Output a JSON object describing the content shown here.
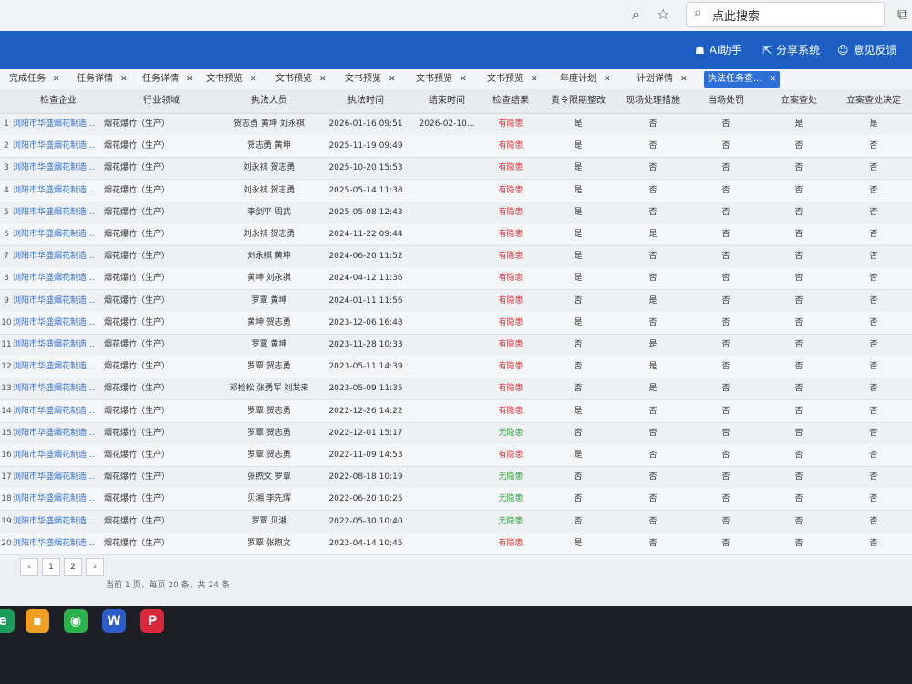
{
  "topbar": {
    "search_placeholder": "点此搜索"
  },
  "header": {
    "ai_label": "AI助手",
    "share_label": "分享系统",
    "feedback_label": "意见反馈"
  },
  "tabs": [
    {
      "label": "完成任务",
      "active": false
    },
    {
      "label": "任务详情",
      "active": false
    },
    {
      "label": "任务详情",
      "active": false
    },
    {
      "label": "文书预览",
      "active": false
    },
    {
      "label": "文书预览",
      "active": false
    },
    {
      "label": "文书预览",
      "active": false
    },
    {
      "label": "文书预览",
      "active": false
    },
    {
      "label": "文书预览",
      "active": false
    },
    {
      "label": "年度计划",
      "active": false
    },
    {
      "label": "计划详情",
      "active": false
    },
    {
      "label": "执法任务查...",
      "active": true
    }
  ],
  "table": {
    "columns": [
      "检查企业",
      "行业领域",
      "执法人员",
      "执法时间",
      "结束时间",
      "检查结果",
      "责令限期整改",
      "现场处理措施",
      "当场处罚",
      "立案查处",
      "立案查处决定"
    ],
    "rows": [
      [
        "1",
        "浏阳市华盛烟花制造...",
        "烟花爆竹（生产）",
        "贺志勇 黄坤 刘永祺",
        "2026-01-16 09:51",
        "2026-02-10...",
        "有隐患",
        "是",
        "否",
        "否",
        "是",
        "是"
      ],
      [
        "2",
        "浏阳市华盛烟花制造...",
        "烟花爆竹（生产）",
        "贺志勇 黄坤",
        "2025-11-19 09:49",
        "",
        "有隐患",
        "是",
        "否",
        "否",
        "否",
        "否"
      ],
      [
        "3",
        "浏阳市华盛烟花制造...",
        "烟花爆竹（生产）",
        "刘永祺 贺志勇",
        "2025-10-20 15:53",
        "",
        "有隐患",
        "是",
        "否",
        "否",
        "否",
        "否"
      ],
      [
        "4",
        "浏阳市华盛烟花制造...",
        "烟花爆竹（生产）",
        "刘永祺 贺志勇",
        "2025-05-14 11:38",
        "",
        "有隐患",
        "是",
        "否",
        "否",
        "否",
        "否"
      ],
      [
        "5",
        "浏阳市华盛烟花制造...",
        "烟花爆竹（生产）",
        "李剑平 周武",
        "2025-05-08 12:43",
        "",
        "有隐患",
        "是",
        "否",
        "否",
        "否",
        "否"
      ],
      [
        "6",
        "浏阳市华盛烟花制造...",
        "烟花爆竹（生产）",
        "刘永祺 贺志勇",
        "2024-11-22 09:44",
        "",
        "有隐患",
        "是",
        "是",
        "否",
        "否",
        "否"
      ],
      [
        "7",
        "浏阳市华盛烟花制造...",
        "烟花爆竹（生产）",
        "刘永祺 黄坤",
        "2024-06-20 11:52",
        "",
        "有隐患",
        "是",
        "否",
        "否",
        "否",
        "否"
      ],
      [
        "8",
        "浏阳市华盛烟花制造...",
        "烟花爆竹（生产）",
        "黄坤 刘永祺",
        "2024-04-12 11:36",
        "",
        "有隐患",
        "是",
        "否",
        "否",
        "否",
        "否"
      ],
      [
        "9",
        "浏阳市华盛烟花制造...",
        "烟花爆竹（生产）",
        "罗覃 黄坤",
        "2024-01-11 11:56",
        "",
        "有隐患",
        "否",
        "是",
        "否",
        "否",
        "否"
      ],
      [
        "10",
        "浏阳市华盛烟花制造...",
        "烟花爆竹（生产）",
        "黄坤 贺志勇",
        "2023-12-06 16:48",
        "",
        "有隐患",
        "是",
        "否",
        "否",
        "否",
        "否"
      ],
      [
        "11",
        "浏阳市华盛烟花制造...",
        "烟花爆竹（生产）",
        "罗覃 黄坤",
        "2023-11-28 10:33",
        "",
        "有隐患",
        "否",
        "是",
        "否",
        "否",
        "否"
      ],
      [
        "12",
        "浏阳市华盛烟花制造...",
        "烟花爆竹（生产）",
        "罗覃 贺志勇",
        "2023-05-11 14:39",
        "",
        "有隐患",
        "否",
        "是",
        "否",
        "否",
        "否"
      ],
      [
        "13",
        "浏阳市华盛烟花制造...",
        "烟花爆竹（生产）",
        "邓检松 张勇军 刘发来",
        "2023-05-09 11:35",
        "",
        "有隐患",
        "否",
        "是",
        "否",
        "否",
        "否"
      ],
      [
        "14",
        "浏阳市华盛烟花制造...",
        "烟花爆竹（生产）",
        "罗覃 贺志勇",
        "2022-12-26 14:22",
        "",
        "有隐患",
        "是",
        "否",
        "否",
        "否",
        "否"
      ],
      [
        "15",
        "浏阳市华盛烟花制造...",
        "烟花爆竹（生产）",
        "罗覃 贺志勇",
        "2022-12-01 15:17",
        "",
        "无隐患",
        "否",
        "否",
        "否",
        "否",
        "否"
      ],
      [
        "16",
        "浏阳市华盛烟花制造...",
        "烟花爆竹（生产）",
        "罗覃 贺志勇",
        "2022-11-09 14:53",
        "",
        "有隐患",
        "是",
        "否",
        "否",
        "否",
        "否"
      ],
      [
        "17",
        "浏阳市华盛烟花制造...",
        "烟花爆竹（生产）",
        "张煦文 罗覃",
        "2022-08-18 10:19",
        "",
        "无隐患",
        "否",
        "否",
        "否",
        "否",
        "否"
      ],
      [
        "18",
        "浏阳市华盛烟花制造...",
        "烟花爆竹（生产）",
        "贝湘 李先辉",
        "2022-06-20 10:25",
        "",
        "无隐患",
        "否",
        "否",
        "否",
        "否",
        "否"
      ],
      [
        "19",
        "浏阳市华盛烟花制造...",
        "烟花爆竹（生产）",
        "罗覃 贝湘",
        "2022-05-30 10:40",
        "",
        "无隐患",
        "否",
        "否",
        "否",
        "否",
        "否"
      ],
      [
        "20",
        "浏阳市华盛烟花制造...",
        "烟花爆竹（生产）",
        "罗覃 张煦文",
        "2022-04-14 10:45",
        "",
        "有隐患",
        "是",
        "否",
        "否",
        "否",
        "否"
      ]
    ]
  },
  "pagination": {
    "prev": "‹",
    "pages": [
      "1",
      "2"
    ],
    "next": "›",
    "info": "当前 1 页，每页 20 条，共 24 条"
  },
  "taskbar_apps": [
    {
      "name": "app-orange",
      "color": "#f0a020",
      "glyph": "▪"
    },
    {
      "name": "wechat",
      "color": "#2bb24c",
      "glyph": "◉"
    },
    {
      "name": "word",
      "color": "#2b5cc9",
      "glyph": "W"
    },
    {
      "name": "pdf",
      "color": "#d8283a",
      "glyph": "P"
    }
  ]
}
